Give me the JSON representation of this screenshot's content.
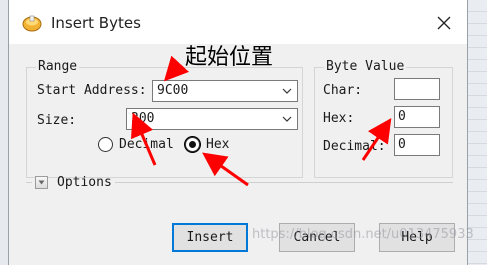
{
  "window": {
    "title": "Insert Bytes",
    "close_glyph": "✕"
  },
  "range": {
    "legend": "Range",
    "start_address_label": "Start Address:",
    "start_address_value": "9C00",
    "size_label": "Size:",
    "size_value": "200",
    "decimal_label": "Decimal",
    "hex_label": "Hex",
    "selected_radix": "Hex"
  },
  "byte_value": {
    "legend": "Byte Value",
    "char_label": "Char:",
    "char_value": "",
    "hex_label": "Hex:",
    "hex_value": "0",
    "decimal_label": "Decimal:",
    "decimal_value": "0"
  },
  "options": {
    "label": "Options",
    "expanded": false
  },
  "buttons": {
    "insert": "Insert",
    "cancel": "Cancel",
    "help": "Help"
  },
  "annotation": {
    "text": "起始位置",
    "arrow_color": "#ff0000"
  },
  "watermark": "https://blog.csdn.net/u013475933",
  "colors": {
    "accent": "#0078d7",
    "annotation": "#ff0000"
  }
}
